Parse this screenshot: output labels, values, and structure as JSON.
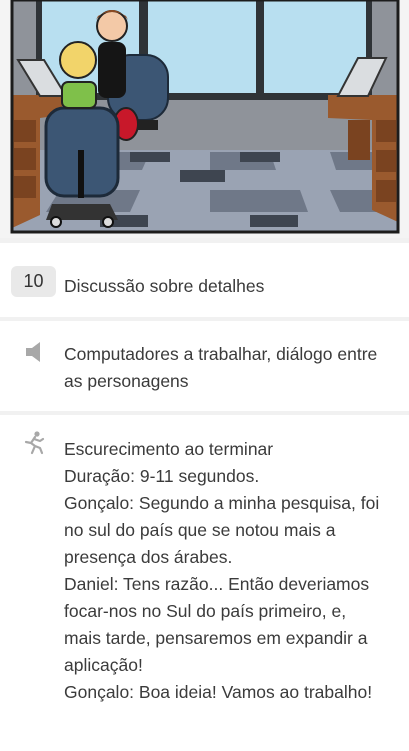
{
  "shot": {
    "number": "10",
    "title": "Discussão sobre detalhes"
  },
  "sound": {
    "icon": "speaker-icon",
    "text": "Computadores a trabalhar, diálogo entre as personagens"
  },
  "action": {
    "icon": "running-person-icon",
    "text": "Escurecimento ao terminar\nDuração: 9-11 segundos.\nGonçalo: Segundo a minha pesquisa, foi no sul do país que se notou mais a presença dos árabes.\nDaniel: Tens razão... Então deveriamos focar-nos no Sul do país primeiro, e, mais tarde, pensaremos em expandir a aplicação!\nGonçalo: Boa ideia! Vamos ao trabalho!"
  },
  "colors": {
    "background": "#f1f1f1",
    "card": "#ffffff",
    "badge": "#e9e9e9",
    "icon_gray": "#a8a8a8"
  }
}
